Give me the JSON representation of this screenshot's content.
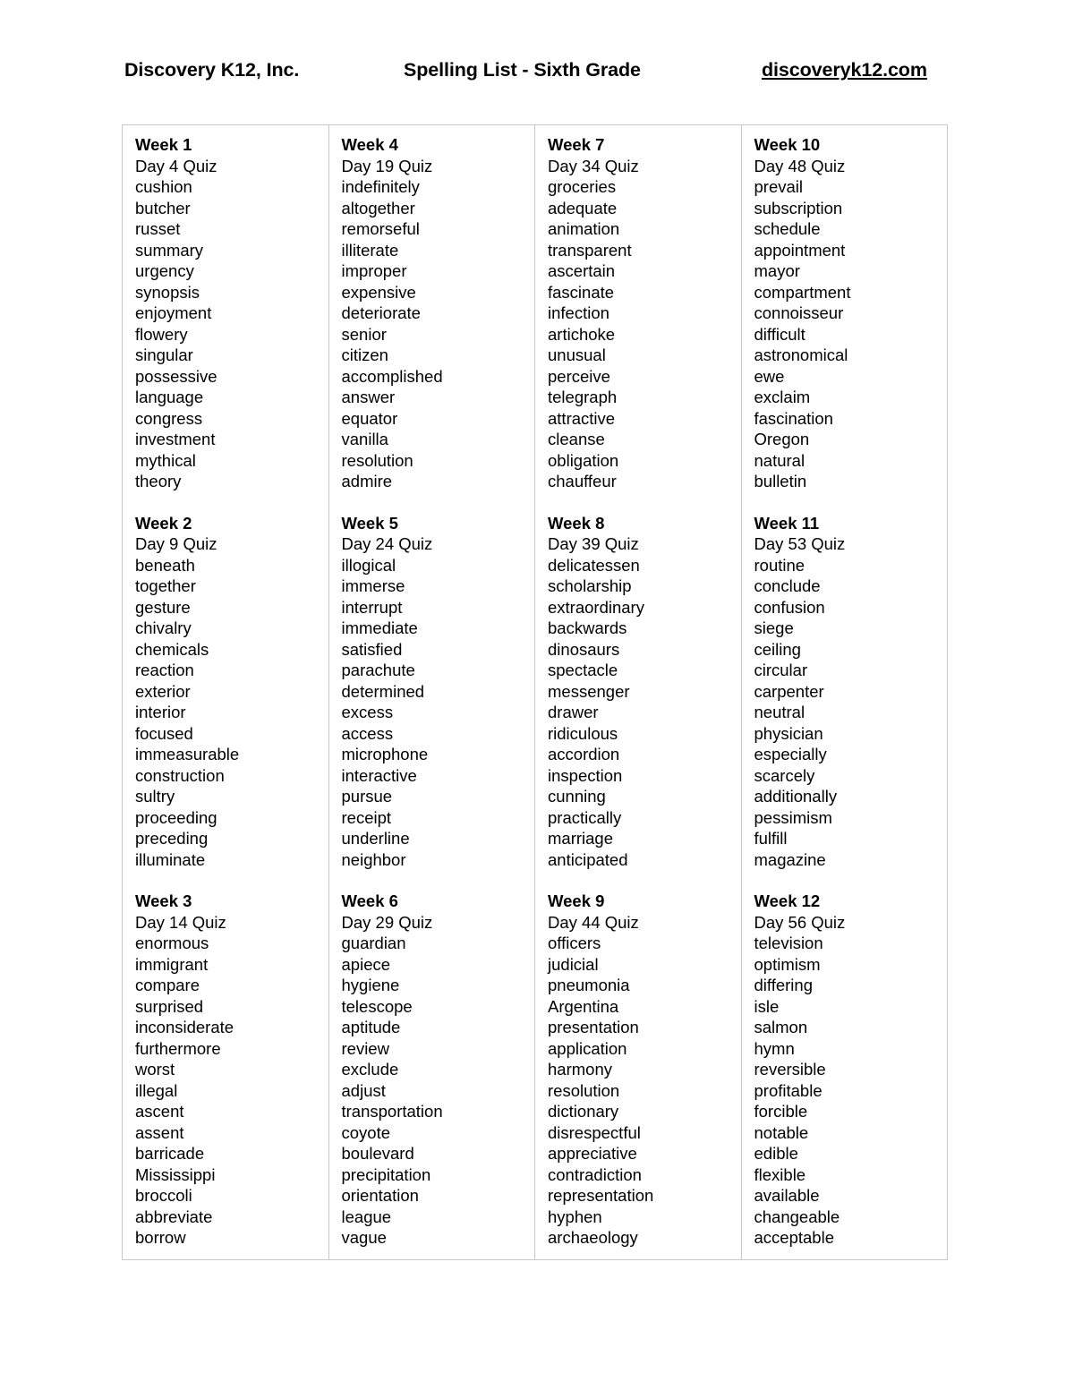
{
  "header": {
    "org": "Discovery K12, Inc.",
    "title": "Spelling List - Sixth Grade",
    "website": "discoveryk12.com"
  },
  "columns": [
    {
      "weeks": [
        {
          "week": "Week 1",
          "quiz": "Day 4 Quiz",
          "words": [
            "cushion",
            "butcher",
            "russet",
            "summary",
            "urgency",
            "synopsis",
            "enjoyment",
            "flowery",
            "singular",
            "possessive",
            "language",
            "congress",
            "investment",
            "mythical",
            "theory"
          ]
        },
        {
          "week": "Week 2",
          "quiz": "Day 9 Quiz",
          "words": [
            "beneath",
            "together",
            "gesture",
            "chivalry",
            "chemicals",
            "reaction",
            "exterior",
            "interior",
            "focused",
            "immeasurable",
            "construction",
            "sultry",
            "proceeding",
            "preceding",
            "illuminate"
          ]
        },
        {
          "week": "Week 3",
          "quiz": "Day 14 Quiz",
          "words": [
            "enormous",
            "immigrant",
            "compare",
            "surprised",
            "inconsiderate",
            "furthermore",
            "worst",
            "illegal",
            "ascent",
            "assent",
            "barricade",
            "Mississippi",
            "broccoli",
            "abbreviate",
            "borrow"
          ]
        }
      ]
    },
    {
      "weeks": [
        {
          "week": "Week 4",
          "quiz": "Day 19 Quiz",
          "words": [
            "indefinitely",
            "altogether",
            "remorseful",
            "illiterate",
            "improper",
            "expensive",
            "deteriorate",
            "senior",
            "citizen",
            "accomplished",
            "answer",
            "equator",
            "vanilla",
            "resolution",
            "admire"
          ]
        },
        {
          "week": "Week 5",
          "quiz": "Day 24 Quiz",
          "words": [
            "illogical",
            "immerse",
            "interrupt",
            "immediate",
            "satisfied",
            "parachute",
            "determined",
            "excess",
            "access",
            "microphone",
            "interactive",
            "pursue",
            "receipt",
            "underline",
            "neighbor"
          ]
        },
        {
          "week": "Week 6",
          "quiz": "Day 29 Quiz",
          "words": [
            "guardian",
            "apiece",
            "hygiene",
            "telescope",
            "aptitude",
            "review",
            "exclude",
            "adjust",
            "transportation",
            "coyote",
            "boulevard",
            "precipitation",
            "orientation",
            "league",
            "vague"
          ]
        }
      ]
    },
    {
      "weeks": [
        {
          "week": "Week 7",
          "quiz": "Day 34 Quiz",
          "words": [
            "groceries",
            "adequate",
            "animation",
            "transparent",
            "ascertain",
            "fascinate",
            "infection",
            "artichoke",
            "unusual",
            "perceive",
            "telegraph",
            "attractive",
            "cleanse",
            "obligation",
            "chauffeur"
          ]
        },
        {
          "week": "Week 8",
          "quiz": "Day 39 Quiz",
          "words": [
            "delicatessen",
            "scholarship",
            "extraordinary",
            "backwards",
            "dinosaurs",
            "spectacle",
            "messenger",
            "drawer",
            "ridiculous",
            "accordion",
            "inspection",
            "cunning",
            "practically",
            "marriage",
            "anticipated"
          ]
        },
        {
          "week": "Week 9",
          "quiz": "Day 44 Quiz",
          "words": [
            "officers",
            "judicial",
            "pneumonia",
            "Argentina",
            "presentation",
            "application",
            "harmony",
            "resolution",
            "dictionary",
            "disrespectful",
            "appreciative",
            "contradiction",
            "representation",
            "hyphen",
            "archaeology"
          ]
        }
      ]
    },
    {
      "weeks": [
        {
          "week": "Week 10",
          "quiz": "Day 48 Quiz",
          "words": [
            "prevail",
            "subscription",
            "schedule",
            "appointment",
            "mayor",
            "compartment",
            "connoisseur",
            "difficult",
            "astronomical",
            "ewe",
            "exclaim",
            "fascination",
            "Oregon",
            "natural",
            "bulletin"
          ]
        },
        {
          "week": "Week 11",
          "quiz": "Day 53 Quiz",
          "words": [
            "routine",
            "conclude",
            "confusion",
            "siege",
            "ceiling",
            "circular",
            "carpenter",
            "neutral",
            "physician",
            "especially",
            "scarcely",
            "additionally",
            "pessimism",
            "fulfill",
            "magazine"
          ]
        },
        {
          "week": "Week 12",
          "quiz": "Day 56 Quiz",
          "words": [
            "television",
            "optimism",
            "differing",
            "isle",
            "salmon",
            "hymn",
            "reversible",
            "profitable",
            "forcible",
            "notable",
            "edible",
            "flexible",
            "available",
            "changeable",
            "acceptable"
          ]
        }
      ]
    }
  ],
  "colors": {
    "text": "#000000",
    "border": "#c8c8c8",
    "background": "#ffffff"
  }
}
